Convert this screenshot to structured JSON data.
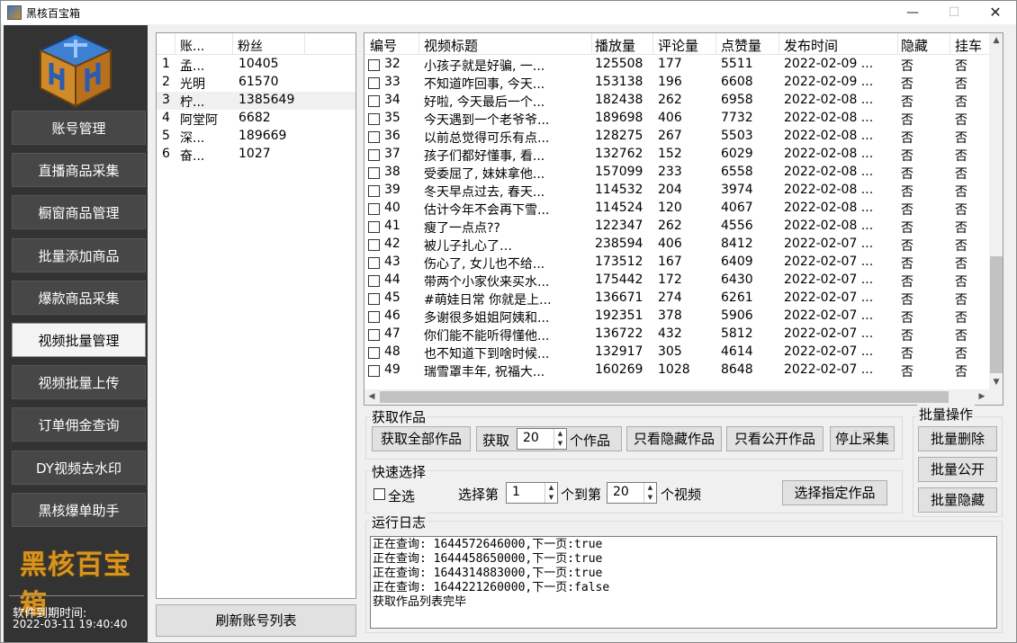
{
  "window": {
    "title": "黑核百宝箱",
    "min_icon": "—",
    "max_icon": "☐",
    "close_icon": "✕"
  },
  "sidebar": {
    "nav": [
      {
        "label": "账号管理",
        "active": false
      },
      {
        "label": "直播商品采集",
        "active": false
      },
      {
        "label": "橱窗商品管理",
        "active": false
      },
      {
        "label": "批量添加商品",
        "active": false
      },
      {
        "label": "爆款商品采集",
        "active": false
      },
      {
        "label": "视频批量管理",
        "active": true
      },
      {
        "label": "视频批量上传",
        "active": false
      },
      {
        "label": "订单佣金查询",
        "active": false
      },
      {
        "label": "DY视频去水印",
        "active": false
      },
      {
        "label": "黑核爆单助手",
        "active": false
      }
    ],
    "brand": "黑核百宝箱",
    "expire_label": "软件到期时间:",
    "expire_date": "2022-03-11 19:40:40"
  },
  "accounts": {
    "headers": {
      "account": "账...",
      "fans": "粉丝"
    },
    "rows": [
      {
        "idx": "1",
        "name": "孟...",
        "fans": "10405"
      },
      {
        "idx": "2",
        "name": "光明",
        "fans": "61570"
      },
      {
        "idx": "3",
        "name": "柠...",
        "fans": "1385649"
      },
      {
        "idx": "4",
        "name": "阿堂阿",
        "fans": "6682"
      },
      {
        "idx": "5",
        "name": "深...",
        "fans": "189669"
      },
      {
        "idx": "6",
        "name": "奋...",
        "fans": "1027"
      }
    ],
    "selected_index": 2,
    "refresh_label": "刷新账号列表"
  },
  "videos": {
    "headers": {
      "id": "编号",
      "title": "视频标题",
      "plays": "播放量",
      "comments": "评论量",
      "likes": "点赞量",
      "time": "发布时间",
      "hidden": "隐藏",
      "cart": "挂车"
    },
    "rows": [
      {
        "id": "32",
        "title": "小孩子就是好骗, 一...",
        "plays": "125508",
        "comments": "177",
        "likes": "5511",
        "time": "2022-02-09 ...",
        "hidden": "否",
        "cart": "否"
      },
      {
        "id": "33",
        "title": "不知道咋回事, 今天...",
        "plays": "153138",
        "comments": "196",
        "likes": "6608",
        "time": "2022-02-09 ...",
        "hidden": "否",
        "cart": "否"
      },
      {
        "id": "34",
        "title": "好啦, 今天最后一个...",
        "plays": "182438",
        "comments": "262",
        "likes": "6958",
        "time": "2022-02-08 ...",
        "hidden": "否",
        "cart": "否"
      },
      {
        "id": "35",
        "title": "今天遇到一个老爷爷...",
        "plays": "189698",
        "comments": "406",
        "likes": "7732",
        "time": "2022-02-08 ...",
        "hidden": "否",
        "cart": "否"
      },
      {
        "id": "36",
        "title": "以前总觉得可乐有点...",
        "plays": "128275",
        "comments": "267",
        "likes": "5503",
        "time": "2022-02-08 ...",
        "hidden": "否",
        "cart": "否"
      },
      {
        "id": "37",
        "title": "孩子们都好懂事, 看...",
        "plays": "132762",
        "comments": "152",
        "likes": "6029",
        "time": "2022-02-08 ...",
        "hidden": "否",
        "cart": "否"
      },
      {
        "id": "38",
        "title": "受委屈了, 妹妹拿他...",
        "plays": "157099",
        "comments": "233",
        "likes": "6558",
        "time": "2022-02-08 ...",
        "hidden": "否",
        "cart": "否"
      },
      {
        "id": "39",
        "title": "冬天早点过去, 春天...",
        "plays": "114532",
        "comments": "204",
        "likes": "3974",
        "time": "2022-02-08 ...",
        "hidden": "否",
        "cart": "否"
      },
      {
        "id": "40",
        "title": "估计今年不会再下雪...",
        "plays": "114524",
        "comments": "120",
        "likes": "4067",
        "time": "2022-02-08 ...",
        "hidden": "否",
        "cart": "否"
      },
      {
        "id": "41",
        "title": "瘦了一点点??",
        "plays": "122347",
        "comments": "262",
        "likes": "4556",
        "time": "2022-02-08 ...",
        "hidden": "否",
        "cart": "否"
      },
      {
        "id": "42",
        "title": "被儿子扎心了…",
        "plays": "238594",
        "comments": "406",
        "likes": "8412",
        "time": "2022-02-07 ...",
        "hidden": "否",
        "cart": "否"
      },
      {
        "id": "43",
        "title": "伤心了, 女儿也不给...",
        "plays": "173512",
        "comments": "167",
        "likes": "6409",
        "time": "2022-02-07 ...",
        "hidden": "否",
        "cart": "否"
      },
      {
        "id": "44",
        "title": "带两个小家伙来买水...",
        "plays": "175442",
        "comments": "172",
        "likes": "6430",
        "time": "2022-02-07 ...",
        "hidden": "否",
        "cart": "否"
      },
      {
        "id": "45",
        "title": "#萌娃日常 你就是上...",
        "plays": "136671",
        "comments": "274",
        "likes": "6261",
        "time": "2022-02-07 ...",
        "hidden": "否",
        "cart": "否"
      },
      {
        "id": "46",
        "title": "多谢很多姐姐阿姨和...",
        "plays": "192351",
        "comments": "378",
        "likes": "5906",
        "time": "2022-02-07 ...",
        "hidden": "否",
        "cart": "否"
      },
      {
        "id": "47",
        "title": "你们能不能听得懂他...",
        "plays": "136722",
        "comments": "432",
        "likes": "5812",
        "time": "2022-02-07 ...",
        "hidden": "否",
        "cart": "否"
      },
      {
        "id": "48",
        "title": "也不知道下到啥时候...",
        "plays": "132917",
        "comments": "305",
        "likes": "4614",
        "time": "2022-02-07 ...",
        "hidden": "否",
        "cart": "否"
      },
      {
        "id": "49",
        "title": "瑞雪罩丰年, 祝福大...",
        "plays": "160269",
        "comments": "1028",
        "likes": "8648",
        "time": "2022-02-07 ...",
        "hidden": "否",
        "cart": "否"
      }
    ]
  },
  "fetch": {
    "group_title": "获取作品",
    "fetch_all": "获取全部作品",
    "fetch_prefix": "获取",
    "fetch_count": "20",
    "fetch_suffix": "个作品",
    "only_hidden": "只看隐藏作品",
    "only_public": "只看公开作品",
    "stop": "停止采集"
  },
  "batch": {
    "group_title": "批量操作",
    "delete": "批量删除",
    "public": "批量公开",
    "hide": "批量隐藏"
  },
  "quick": {
    "group_title": "快速选择",
    "select_all": "全选",
    "select_from": "选择第",
    "from_value": "1",
    "to_label": "个到第",
    "to_value": "20",
    "unit": "个视频",
    "select_btn": "选择指定作品"
  },
  "log": {
    "group_title": "运行日志",
    "lines": [
      "正在查询: 1644572646000,下一页:true",
      "正在查询: 1644458650000,下一页:true",
      "正在查询: 1644314883000,下一页:true",
      "正在查询: 1644221260000,下一页:false",
      "获取作品列表完毕"
    ]
  }
}
